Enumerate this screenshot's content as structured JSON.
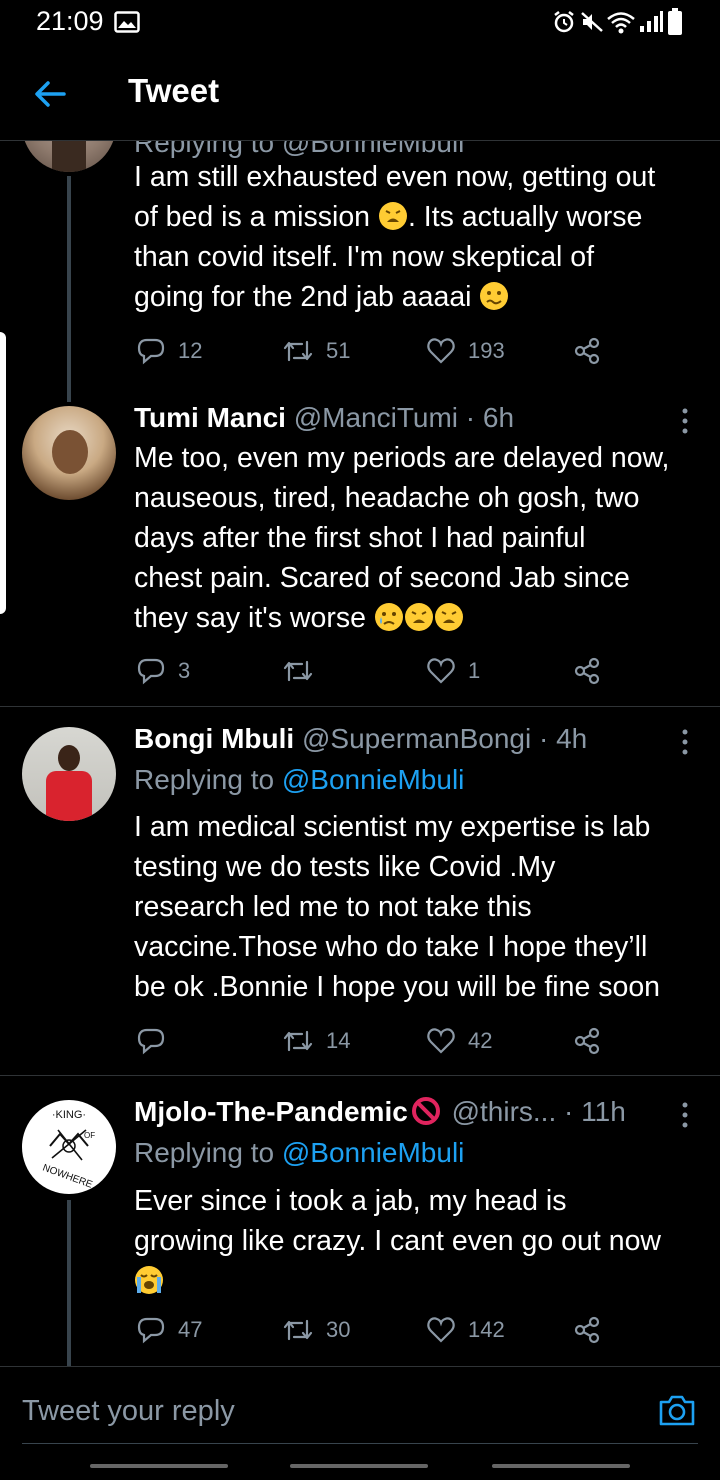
{
  "status": {
    "time": "21:09"
  },
  "header": {
    "title": "Tweet"
  },
  "tweets": [
    {
      "partial_reply_line": "Replying to @BonnieMbuli",
      "text_lines": [
        "I am still exhausted even now, getting out",
        "of bed is a mission",
        ". Its actually worse",
        "than covid itself. I'm now skeptical of",
        "going for the 2nd jab aaaai"
      ],
      "replies": "12",
      "retweets": "51",
      "likes": "193"
    },
    {
      "name": "Tumi Manci",
      "handle": "@ManciTumi",
      "time": "· 6h",
      "text_lines": [
        "Me too, even my periods are delayed now,",
        "nauseous, tired, headache oh gosh, two",
        "days  after the first shot I had painful",
        "chest pain. Scared of second Jab since",
        "they say it's worse"
      ],
      "replies": "3",
      "retweets": "",
      "likes": "1"
    },
    {
      "name": "Bongi Mbuli",
      "handle": "@SupermanBongi",
      "time": "· 4h",
      "reply_prefix": "Replying to",
      "reply_mention": "@BonnieMbuli",
      "text_lines": [
        "I am medical scientist my expertise is lab",
        "testing we do tests like Covid .My",
        "research led me to not take this",
        "vaccine.Those who do take I hope they’ll",
        "be ok .Bonnie I hope you will be fine soon"
      ],
      "replies": "",
      "retweets": "14",
      "likes": "42"
    },
    {
      "name": "Mjolo-The-Pandemic",
      "handle": "@thirs...",
      "time": "· 11h",
      "reply_prefix": "Replying to",
      "reply_mention": "@BonnieMbuli",
      "avatar_logo_text": "KING OF NOWHERE",
      "text_lines": [
        "Ever since i took a jab, my head is",
        "growing like crazy. I cant even go out now"
      ],
      "replies": "47",
      "retweets": "30",
      "likes": "142"
    }
  ],
  "reply_box": {
    "placeholder": "Tweet your reply"
  },
  "icons": {
    "back": "arrow-left-icon",
    "more": "more-vertical-icon",
    "reply": "reply-icon",
    "retweet": "retweet-icon",
    "like": "heart-icon",
    "share": "share-icon",
    "camera": "camera-icon",
    "weary": "weary-face-emoji",
    "woozy": "woozy-face-emoji",
    "crying": "crying-face-emoji",
    "loudly_crying": "loudly-crying-face-emoji",
    "prohibited": "prohibited-icon",
    "alarm": "alarm-icon",
    "mute": "mute-icon",
    "wifi": "wifi-icon",
    "signal": "signal-icon",
    "battery": "battery-icon",
    "gallery": "gallery-icon"
  },
  "colors": {
    "background": "#000000",
    "accent": "#1da1f2",
    "muted": "#8b98a5",
    "divider": "#2f3336"
  }
}
